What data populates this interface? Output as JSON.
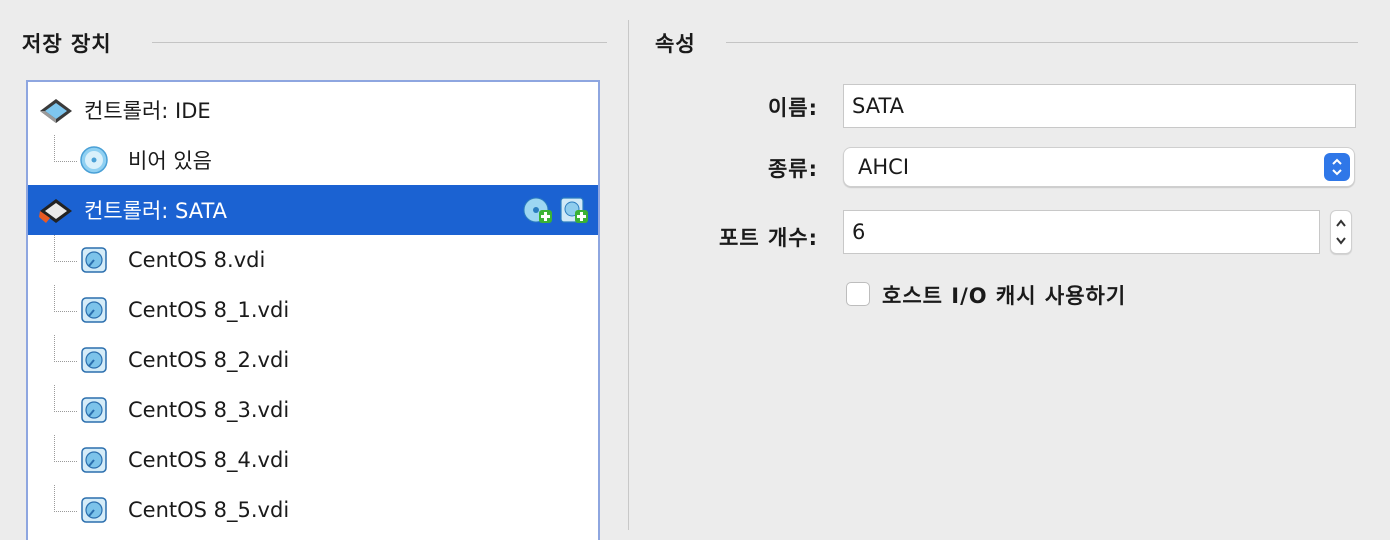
{
  "storage": {
    "title": "저장 장치",
    "controllers": [
      {
        "label": "컨트롤러: IDE",
        "selected": false,
        "children": [
          {
            "label": "비어 있음",
            "icon": "optical-disc-icon"
          }
        ]
      },
      {
        "label": "컨트롤러: SATA",
        "selected": true,
        "children": [
          {
            "label": "CentOS 8.vdi",
            "icon": "hard-disk-icon"
          },
          {
            "label": "CentOS 8_1.vdi",
            "icon": "hard-disk-icon"
          },
          {
            "label": "CentOS 8_2.vdi",
            "icon": "hard-disk-icon"
          },
          {
            "label": "CentOS 8_3.vdi",
            "icon": "hard-disk-icon"
          },
          {
            "label": "CentOS 8_4.vdi",
            "icon": "hard-disk-icon"
          },
          {
            "label": "CentOS 8_5.vdi",
            "icon": "hard-disk-icon"
          }
        ]
      }
    ]
  },
  "attributes": {
    "title": "속성",
    "name_label": "이름:",
    "name_value": "SATA",
    "type_label": "종류:",
    "type_value": "AHCI",
    "port_label": "포트 개수:",
    "port_value": "6",
    "cache_label": "호스트 I/O 캐시 사용하기",
    "cache_checked": false
  },
  "colors": {
    "selection": "#1b62d2",
    "accent": "#2f77e8"
  }
}
